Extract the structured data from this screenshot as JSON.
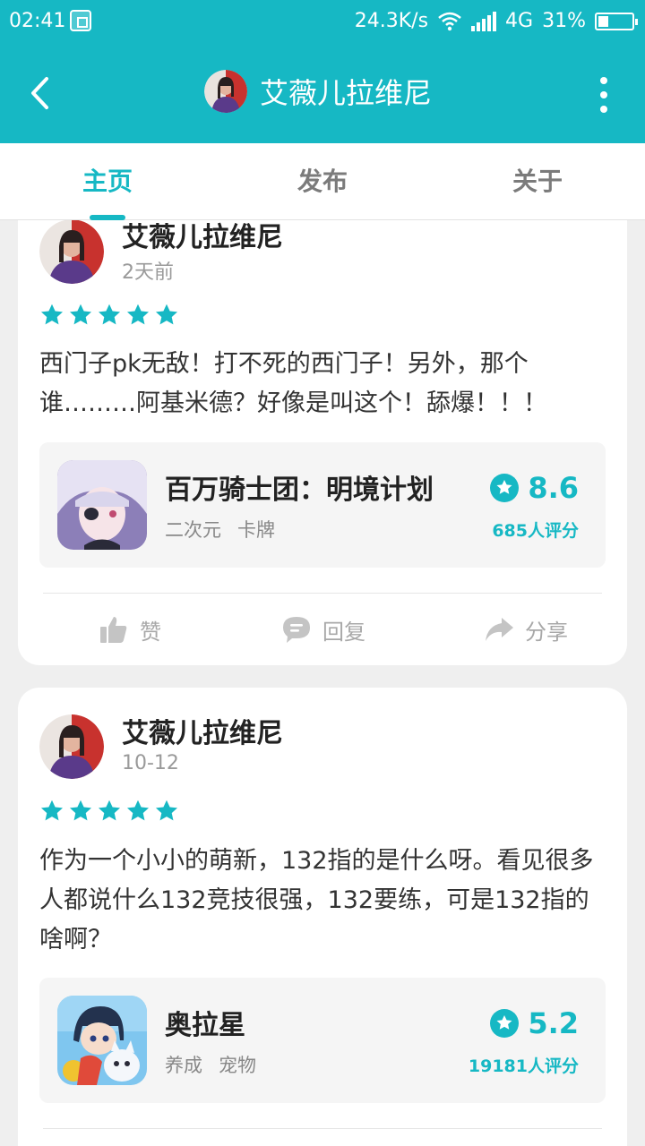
{
  "status": {
    "time": "02:41",
    "speed": "24.3K/s",
    "network": "4G",
    "battery_text": "31%",
    "battery_level": 0.31
  },
  "header": {
    "title": "艾薇儿拉维尼",
    "accent": "#16b8c4"
  },
  "tabs": [
    {
      "label": "主页"
    },
    {
      "label": "发布"
    },
    {
      "label": "关于"
    }
  ],
  "posts": [
    {
      "user": "艾薇儿拉维尼",
      "time": "2天前",
      "rating": 5,
      "text": "西门子pk无敌！打不死的西门子！另外，那个谁………阿基米德？好像是叫这个！舔爆！！！",
      "game": {
        "name": "百万骑士团：明境计划",
        "tags": [
          "二次元",
          "卡牌"
        ],
        "score": "8.6",
        "count": "685人评分"
      },
      "actions": {
        "like": "赞",
        "reply": "回复",
        "share": "分享"
      }
    },
    {
      "user": "艾薇儿拉维尼",
      "time": "10-12",
      "rating": 5,
      "text": "作为一个小小的萌新，132指的是什么呀。看见很多人都说什么132竞技很强，132要练，可是132指的啥啊？",
      "game": {
        "name": "奥拉星",
        "tags": [
          "养成",
          "宠物"
        ],
        "score": "5.2",
        "count": "19181人评分"
      }
    }
  ]
}
